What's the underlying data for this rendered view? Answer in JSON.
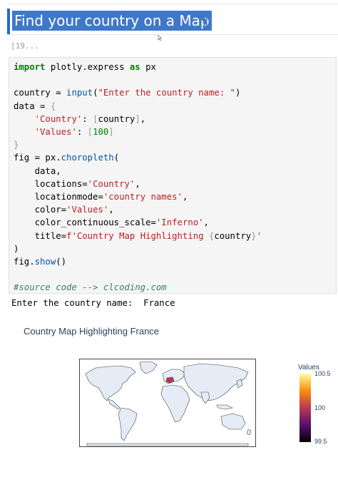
{
  "heading": {
    "text": "Find your country on a Map",
    "pilcrow": "¶"
  },
  "cell": {
    "exec_count": "[19...",
    "code": {
      "l1_import": "import",
      "l1_mod": "plotly.express",
      "l1_as": "as",
      "l1_alias": "px",
      "l3_a": "country = ",
      "l3_fn": "input",
      "l3_b": "(",
      "l3_str": "\"Enter the country name: \"",
      "l3_c": ")",
      "l4": "data = ",
      "l4_br": "{",
      "l5_key": "'Country'",
      "l5_b": ": ",
      "l5_br1": "[",
      "l5_val": "country",
      "l5_br2": "]",
      "l5_c": ",",
      "l6_key": "'Values'",
      "l6_b": ": ",
      "l6_br1": "[",
      "l6_num": "100",
      "l6_br2": "]",
      "l7_br": "}",
      "l8_a": "fig = px.",
      "l8_fn": "choropleth",
      "l8_b": "(",
      "l9": "data,",
      "l10_a": "locations=",
      "l10_s": "'Country'",
      "l10_c": ",",
      "l11_a": "locationmode=",
      "l11_s": "'country names'",
      "l11_c": ",",
      "l12_a": "color=",
      "l12_s": "'Values'",
      "l12_c": ",",
      "l13_a": "color_continuous_scale=",
      "l13_s": "'Inferno'",
      "l13_c": ",",
      "l14_a": "title=",
      "l14_s1": "f'Country Map Highlighting ",
      "l14_br1": "{",
      "l14_v": "country",
      "l14_br2": "}",
      "l14_s2": "'",
      "l15": ")",
      "l16_a": "fig.",
      "l16_fn": "show",
      "l16_b": "()",
      "l18_comment": "#source code --> clcoding.com"
    },
    "stdout": "Enter the country name:  France"
  },
  "plot": {
    "title": "Country Map Highlighting France",
    "colorbar": {
      "title": "Values",
      "ticks": [
        "100.5",
        "100",
        "99.5"
      ]
    },
    "highlight_color": "#c0304c",
    "land_color": "#e5ecf6"
  }
}
